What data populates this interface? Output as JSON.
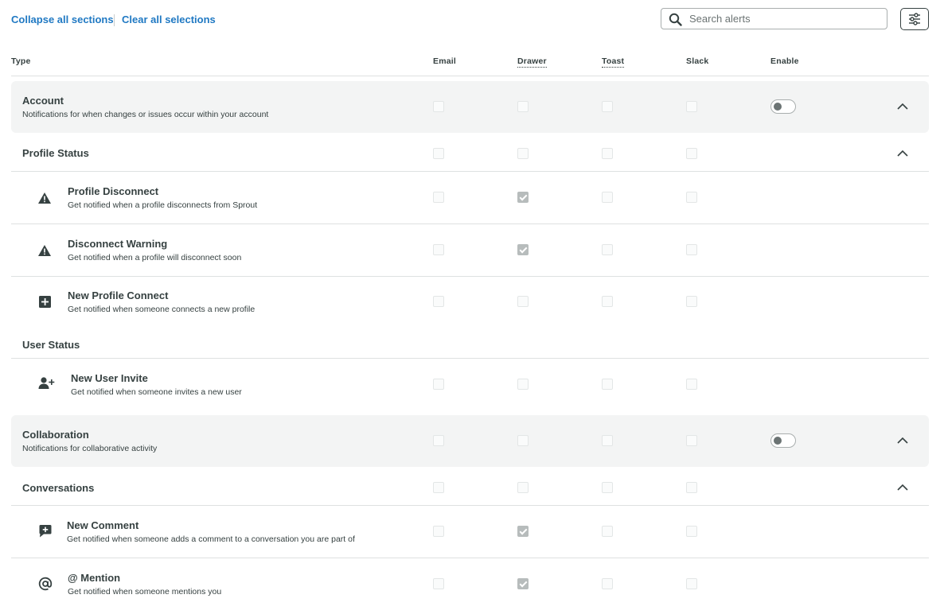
{
  "toolbar": {
    "collapse_label": "Collapse all sections",
    "clear_label": "Clear all selections",
    "search_placeholder": "Search alerts"
  },
  "columns": {
    "type": "Type",
    "email": "Email",
    "drawer": "Drawer",
    "toast": "Toast",
    "slack": "Slack",
    "enable": "Enable"
  },
  "sections": [
    {
      "title": "Account",
      "description": "Notifications for when changes or issues occur within your account",
      "enabled": false,
      "groups": [
        {
          "title": "Profile Status",
          "alerts": [
            {
              "title": "Profile Disconnect",
              "description": "Get notified when a profile disconnects from Sprout",
              "icon": "warning-icon",
              "email": false,
              "drawer": true,
              "toast": false,
              "slack": false
            },
            {
              "title": "Disconnect Warning",
              "description": "Get notified when a profile will disconnect soon",
              "icon": "warning-icon",
              "email": false,
              "drawer": true,
              "toast": false,
              "slack": false
            },
            {
              "title": "New Profile Connect",
              "description": "Get notified when someone connects a new profile",
              "icon": "plus-square-icon",
              "email": false,
              "drawer": false,
              "toast": false,
              "slack": false
            }
          ]
        },
        {
          "title": "User Status",
          "alerts": [
            {
              "title": "New User Invite",
              "description": "Get notified when someone invites a new user",
              "icon": "add-user-icon",
              "email": false,
              "drawer": false,
              "toast": false,
              "slack": false
            }
          ]
        }
      ]
    },
    {
      "title": "Collaboration",
      "description": "Notifications for collaborative activity",
      "enabled": false,
      "groups": [
        {
          "title": "Conversations",
          "alerts": [
            {
              "title": "New Comment",
              "description": "Get notified when someone adds a comment to a conversation you are part of",
              "icon": "comment-icon",
              "email": false,
              "drawer": true,
              "toast": false,
              "slack": false
            },
            {
              "title": "@ Mention",
              "description": "Get notified when someone mentions you",
              "icon": "at-sign-icon",
              "email": false,
              "drawer": true,
              "toast": false,
              "slack": false
            }
          ]
        }
      ]
    }
  ]
}
